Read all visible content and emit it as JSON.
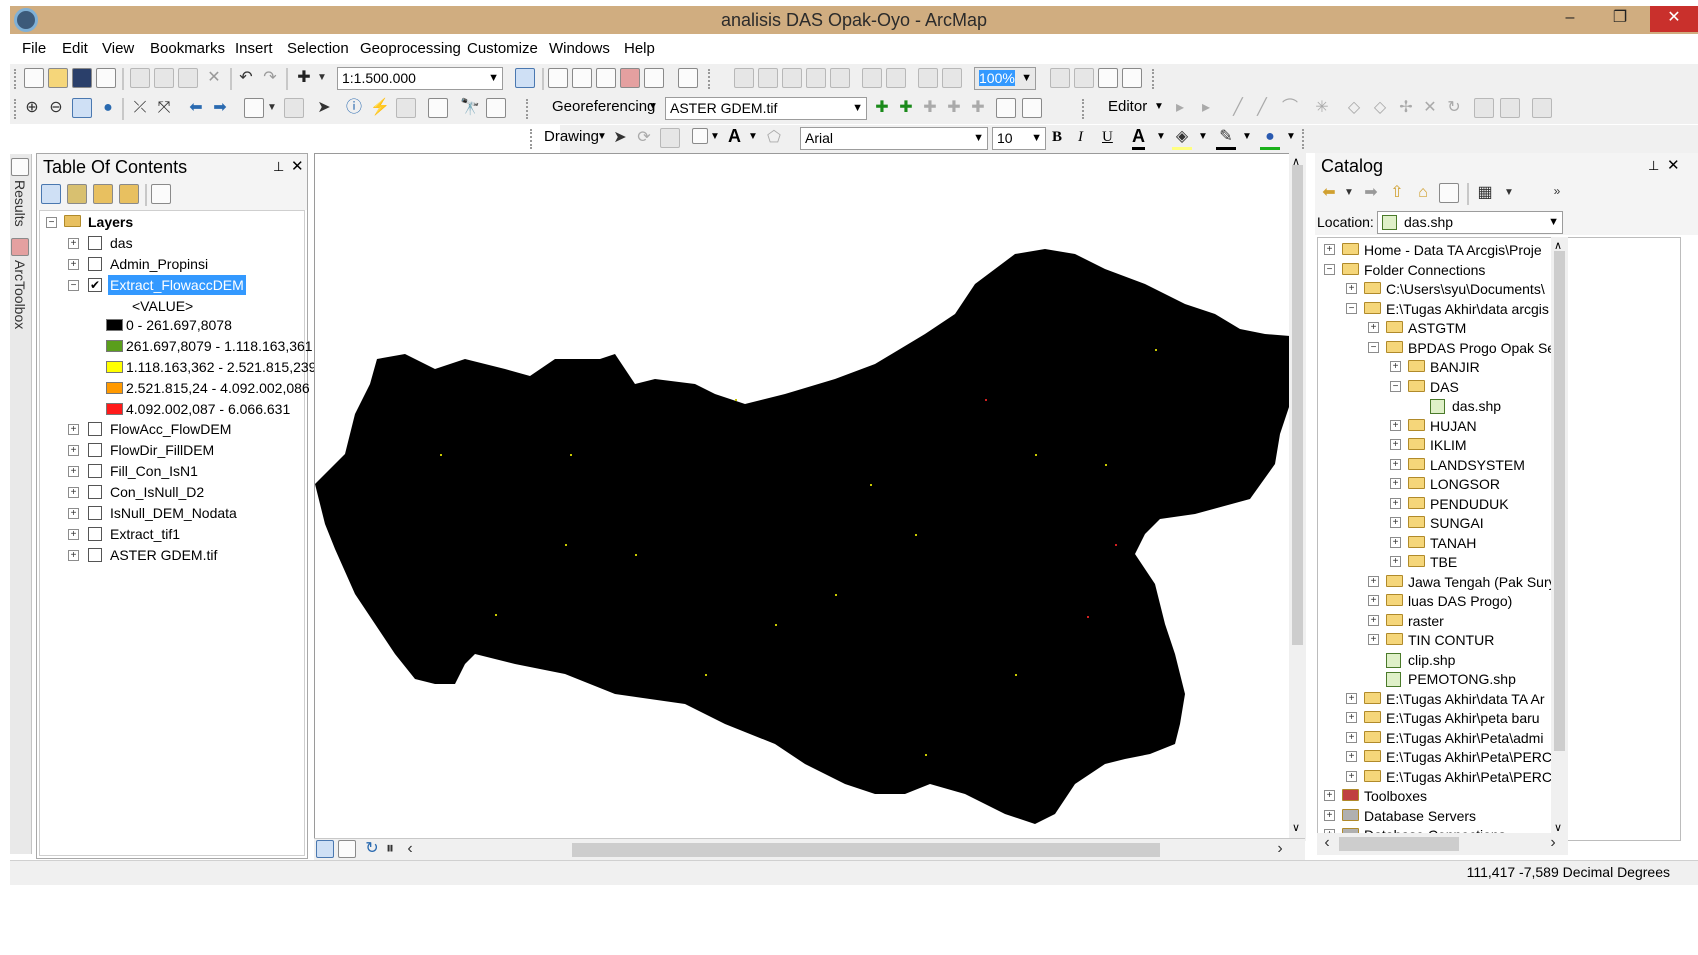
{
  "window": {
    "title": "analisis DAS Opak-Oyo - ArcMap",
    "min": "–",
    "max": "❐",
    "close": "✕"
  },
  "menu": [
    "File",
    "Edit",
    "View",
    "Bookmarks",
    "Insert",
    "Selection",
    "Geoprocessing",
    "Customize",
    "Windows",
    "Help"
  ],
  "toolbar": {
    "scale": "1:1.500.000",
    "zoom_percent": "100%",
    "georef_label": "Georeferencing",
    "georef_layer": "ASTER GDEM.tif",
    "editor_label": "Editor",
    "drawing_label": "Drawing",
    "font_name": "Arial",
    "font_size": "10",
    "bold": "B",
    "italic": "I",
    "underline": "U",
    "text_a": "A"
  },
  "left_tabs": {
    "results": "Results",
    "toolbox": "ArcToolbox"
  },
  "toc": {
    "title": "Table Of Contents",
    "pin": "📌",
    "close": "✕",
    "root": "Layers",
    "layers": [
      {
        "name": "das",
        "checked": false,
        "expanded": false
      },
      {
        "name": "Admin_Propinsi",
        "checked": false,
        "expanded": false
      },
      {
        "name": "Extract_FlowaccDEM",
        "checked": true,
        "expanded": true
      }
    ],
    "value_field": "<VALUE>",
    "legend": [
      {
        "label": "0 - 261.697,8078",
        "color": "#000000"
      },
      {
        "label": "261.697,8079 - 1.118.163,361",
        "color": "#5a9e1c"
      },
      {
        "label": "1.118.163,362 - 2.521.815,239",
        "color": "#ffff00"
      },
      {
        "label": "2.521.815,24 - 4.092.002,086",
        "color": "#ff9900"
      },
      {
        "label": "4.092.002,087 - 6.066.631",
        "color": "#ff1a1a"
      }
    ],
    "more_layers": [
      "FlowAcc_FlowDEM",
      "FlowDir_FillDEM",
      "Fill_Con_IsN1",
      "Con_IsNull_D2",
      "IsNull_DEM_Nodata",
      "Extract_tif1",
      "ASTER GDEM.tif"
    ]
  },
  "catalog": {
    "title": "Catalog",
    "pin": "📌",
    "close": "✕",
    "location_label": "Location:",
    "location_value": "das.shp",
    "tree": [
      {
        "label": "Home - Data TA Arcgis\\Proje",
        "level": 0,
        "sign": "+",
        "type": "home"
      },
      {
        "label": "Folder Connections",
        "level": 0,
        "sign": "−",
        "type": "folder"
      },
      {
        "label": "C:\\Users\\syu\\Documents\\",
        "level": 1,
        "sign": "+",
        "type": "folder"
      },
      {
        "label": "E:\\Tugas Akhir\\data arcgis",
        "level": 1,
        "sign": "−",
        "type": "folder"
      },
      {
        "label": "ASTGTM",
        "level": 2,
        "sign": "+",
        "type": "folder"
      },
      {
        "label": "BPDAS Progo Opak Se",
        "level": 2,
        "sign": "−",
        "type": "folder"
      },
      {
        "label": "BANJIR",
        "level": 3,
        "sign": "+",
        "type": "folder"
      },
      {
        "label": "DAS",
        "level": 3,
        "sign": "−",
        "type": "folder"
      },
      {
        "label": "das.shp",
        "level": 4,
        "sign": "",
        "type": "shp"
      },
      {
        "label": "HUJAN",
        "level": 3,
        "sign": "+",
        "type": "folder"
      },
      {
        "label": "IKLIM",
        "level": 3,
        "sign": "+",
        "type": "folder"
      },
      {
        "label": "LANDSYSTEM",
        "level": 3,
        "sign": "+",
        "type": "folder"
      },
      {
        "label": "LONGSOR",
        "level": 3,
        "sign": "+",
        "type": "folder"
      },
      {
        "label": "PENDUDUK",
        "level": 3,
        "sign": "+",
        "type": "folder"
      },
      {
        "label": "SUNGAI",
        "level": 3,
        "sign": "+",
        "type": "folder"
      },
      {
        "label": "TANAH",
        "level": 3,
        "sign": "+",
        "type": "folder"
      },
      {
        "label": "TBE",
        "level": 3,
        "sign": "+",
        "type": "folder"
      },
      {
        "label": "Jawa Tengah (Pak Sury",
        "level": 2,
        "sign": "+",
        "type": "folder"
      },
      {
        "label": "luas DAS Progo)",
        "level": 2,
        "sign": "+",
        "type": "folder"
      },
      {
        "label": "raster",
        "level": 2,
        "sign": "+",
        "type": "folder"
      },
      {
        "label": "TIN CONTUR",
        "level": 2,
        "sign": "+",
        "type": "folder"
      },
      {
        "label": "clip.shp",
        "level": 2,
        "sign": "",
        "type": "shp"
      },
      {
        "label": "PEMOTONG.shp",
        "level": 2,
        "sign": "",
        "type": "shp"
      },
      {
        "label": "E:\\Tugas Akhir\\data TA Ar",
        "level": 1,
        "sign": "+",
        "type": "folder"
      },
      {
        "label": "E:\\Tugas Akhir\\peta baru",
        "level": 1,
        "sign": "+",
        "type": "folder"
      },
      {
        "label": "E:\\Tugas Akhir\\Peta\\admi",
        "level": 1,
        "sign": "+",
        "type": "folder"
      },
      {
        "label": "E:\\Tugas Akhir\\Peta\\PERC",
        "level": 1,
        "sign": "+",
        "type": "folder"
      },
      {
        "label": "E:\\Tugas Akhir\\Peta\\PERC",
        "level": 1,
        "sign": "+",
        "type": "folder"
      },
      {
        "label": "Toolboxes",
        "level": 0,
        "sign": "+",
        "type": "toolbox"
      },
      {
        "label": "Database Servers",
        "level": 0,
        "sign": "+",
        "type": "db"
      },
      {
        "label": "Database Connections",
        "level": 0,
        "sign": "+",
        "type": "db"
      }
    ]
  },
  "status": {
    "coords": "111,417  -7,589 Decimal Degrees"
  },
  "colors": {
    "titlebar": "#d0ad80",
    "selection": "#3399ff",
    "map_fill": "#000000"
  }
}
